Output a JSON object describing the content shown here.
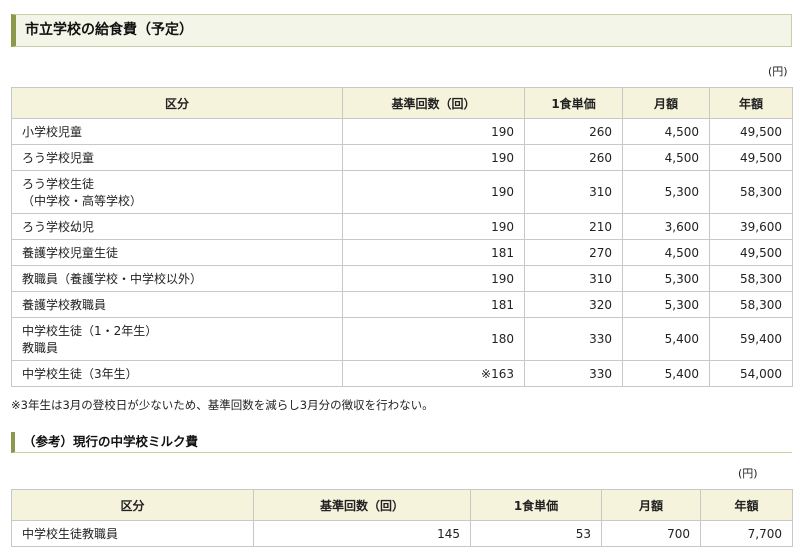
{
  "heading": "市立学校の給食費（予定）",
  "unit": "(円)",
  "table1": {
    "headers": [
      "区分",
      "基準回数（回）",
      "1食単価",
      "月額",
      "年額"
    ],
    "rows": [
      {
        "label1": "小学校児童",
        "label2": "",
        "count": "190",
        "unit_price": "260",
        "monthly": "4,500",
        "annual": "49,500"
      },
      {
        "label1": "ろう学校児童",
        "label2": "",
        "count": "190",
        "unit_price": "260",
        "monthly": "4,500",
        "annual": "49,500"
      },
      {
        "label1": "ろう学校生徒",
        "label2": "（中学校・高等学校）",
        "count": "190",
        "unit_price": "310",
        "monthly": "5,300",
        "annual": "58,300"
      },
      {
        "label1": "ろう学校幼児",
        "label2": "",
        "count": "190",
        "unit_price": "210",
        "monthly": "3,600",
        "annual": "39,600"
      },
      {
        "label1": "養護学校児童生徒",
        "label2": "",
        "count": "181",
        "unit_price": "270",
        "monthly": "4,500",
        "annual": "49,500"
      },
      {
        "label1": "教職員（養護学校・中学校以外）",
        "label2": "",
        "count": "190",
        "unit_price": "310",
        "monthly": "5,300",
        "annual": "58,300"
      },
      {
        "label1": "養護学校教職員",
        "label2": "",
        "count": "181",
        "unit_price": "320",
        "monthly": "5,300",
        "annual": "58,300"
      },
      {
        "label1": "中学校生徒（1・2年生）",
        "label2": "教職員",
        "count": "180",
        "unit_price": "330",
        "monthly": "5,400",
        "annual": "59,400"
      },
      {
        "label1": "中学校生徒（3年生）",
        "label2": "",
        "count": "※163",
        "unit_price": "330",
        "monthly": "5,400",
        "annual": "54,000"
      }
    ]
  },
  "note": "※3年生は3月の登校日が少ないため、基準回数を減らし3月分の徴収を行わない。",
  "heading2": "（参考）現行の中学校ミルク費",
  "unit2": "(円)",
  "table2": {
    "headers": [
      "区分",
      "基準回数（回）",
      "1食単価",
      "月額",
      "年額"
    ],
    "rows": [
      {
        "label1": "中学校生徒教職員",
        "count": "145",
        "unit_price": "53",
        "monthly": "700",
        "annual": "7,700"
      }
    ]
  }
}
